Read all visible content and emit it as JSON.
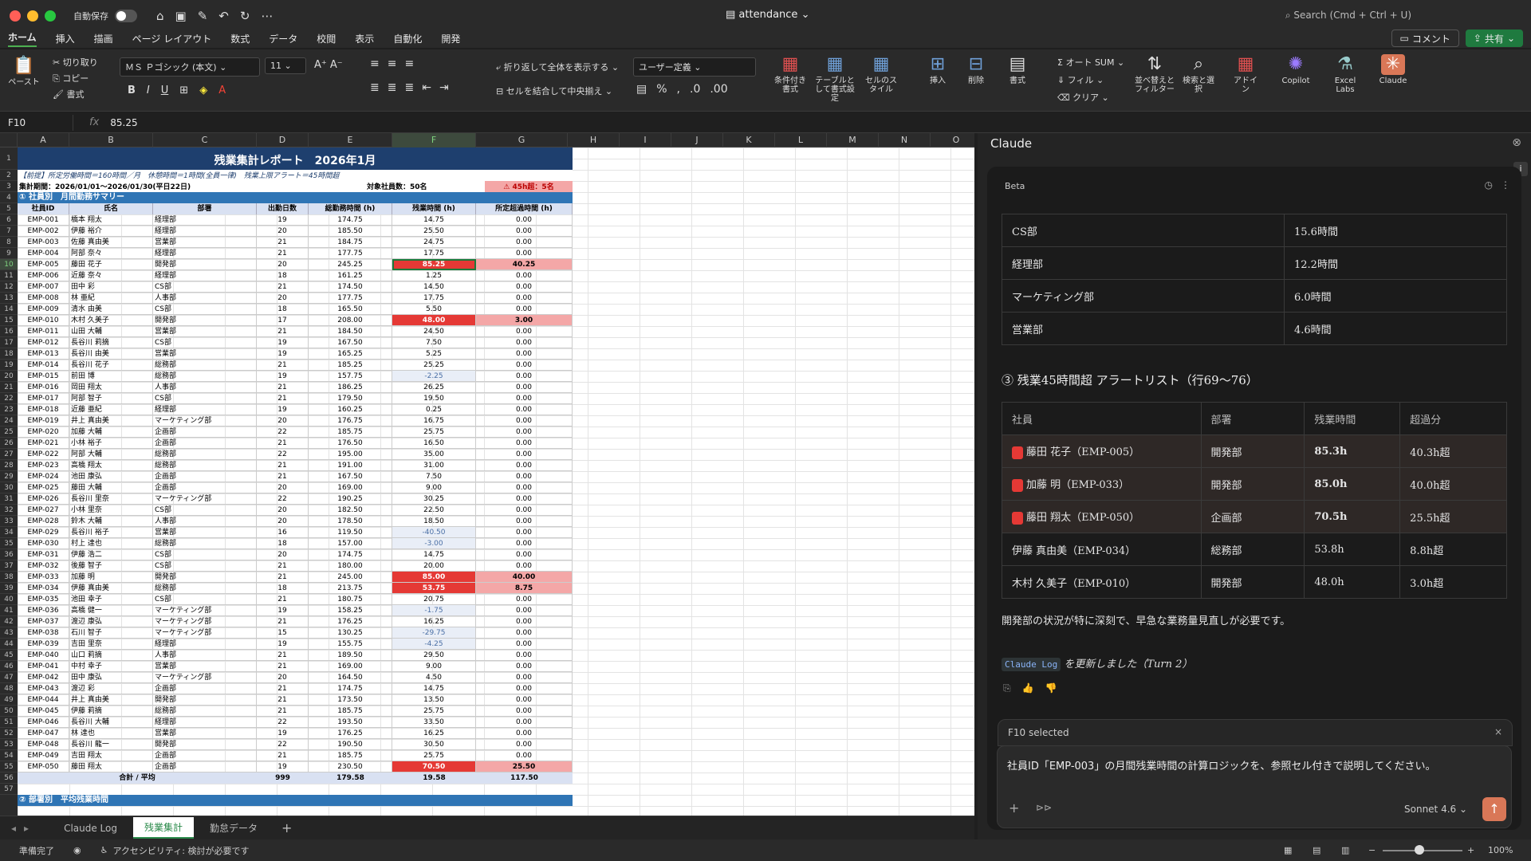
{
  "window": {
    "autosave": "自動保存",
    "doc_title": "attendance",
    "search": "Search (Cmd + Ctrl + U)"
  },
  "menu": {
    "tabs": [
      "ホーム",
      "挿入",
      "描画",
      "ページ レイアウト",
      "数式",
      "データ",
      "校閲",
      "表示",
      "自動化",
      "開発"
    ],
    "comment": "コメント",
    "share": "共有"
  },
  "ribbon": {
    "paste": "ペースト",
    "cut": "切り取り",
    "copy": "コピー",
    "format": "書式",
    "font_name": "ＭＳ Ｐゴシック (本文)",
    "font_size": "11",
    "wrap": "折り返して全体を表示する",
    "merge": "セルを結合して中央揃え",
    "number_format": "ユーザー定義",
    "cond": "条件付き書式",
    "table": "テーブルとして書式設定",
    "cellstyle": "セルのスタイル",
    "insert": "挿入",
    "delete": "削除",
    "format2": "書式",
    "autosum": "オート SUM",
    "fill": "フィル",
    "clear": "クリア",
    "sort": "並べ替えとフィルター",
    "find": "検索と選択",
    "addin": "アドイン",
    "copilot": "Copilot",
    "labs": "Excel Labs",
    "claude": "Claude"
  },
  "formula": {
    "cell": "F10",
    "value": "85.25"
  },
  "columns": [
    "A",
    "B",
    "C",
    "D",
    "E",
    "F",
    "G",
    "H",
    "I",
    "J",
    "K",
    "L",
    "M",
    "N",
    "O"
  ],
  "sheet": {
    "title": "残業集計レポート　2026年1月",
    "premise": "【前提】所定労働時間＝160時間／月　休憩時間＝1時間(全員一律)　残業上限アラート＝45時間超",
    "period": "集計期間：2026/01/01〜2026/01/30(平日22日)",
    "employees": "対象社員数：50名",
    "alert": "45h超：5名",
    "section1": "① 社員別　月間勤務サマリー",
    "headers": [
      "社員ID",
      "氏名",
      "部署",
      "出勤日数",
      "総勤務時間 (h)",
      "残業時間 (h)",
      "所定超過時間 (h)"
    ],
    "rows": [
      [
        "EMP-001",
        "橋本 翔太",
        "経理部",
        "19",
        "174.75",
        "14.75",
        "0.00"
      ],
      [
        "EMP-002",
        "伊藤 裕介",
        "経理部",
        "20",
        "185.50",
        "25.50",
        "0.00"
      ],
      [
        "EMP-003",
        "佐藤 真由美",
        "営業部",
        "21",
        "184.75",
        "24.75",
        "0.00"
      ],
      [
        "EMP-004",
        "阿部 奈々",
        "経理部",
        "21",
        "177.75",
        "17.75",
        "0.00"
      ],
      [
        "EMP-005",
        "藤田 花子",
        "開発部",
        "20",
        "245.25",
        "85.25",
        "40.25"
      ],
      [
        "EMP-006",
        "近藤 奈々",
        "経理部",
        "18",
        "161.25",
        "1.25",
        "0.00"
      ],
      [
        "EMP-007",
        "田中 彩",
        "CS部",
        "21",
        "174.50",
        "14.50",
        "0.00"
      ],
      [
        "EMP-008",
        "林 亜紀",
        "人事部",
        "20",
        "177.75",
        "17.75",
        "0.00"
      ],
      [
        "EMP-009",
        "清水 由美",
        "CS部",
        "18",
        "165.50",
        "5.50",
        "0.00"
      ],
      [
        "EMP-010",
        "木村 久美子",
        "開発部",
        "17",
        "208.00",
        "48.00",
        "3.00"
      ],
      [
        "EMP-011",
        "山田 大輔",
        "営業部",
        "21",
        "184.50",
        "24.50",
        "0.00"
      ],
      [
        "EMP-012",
        "長谷川 莉摘",
        "CS部",
        "19",
        "167.50",
        "7.50",
        "0.00"
      ],
      [
        "EMP-013",
        "長谷川 由美",
        "営業部",
        "19",
        "165.25",
        "5.25",
        "0.00"
      ],
      [
        "EMP-014",
        "長谷川 花子",
        "総務部",
        "21",
        "185.25",
        "25.25",
        "0.00"
      ],
      [
        "EMP-015",
        "前田 博",
        "総務部",
        "19",
        "157.75",
        "-2.25",
        "0.00"
      ],
      [
        "EMP-016",
        "岡田 翔太",
        "人事部",
        "21",
        "186.25",
        "26.25",
        "0.00"
      ],
      [
        "EMP-017",
        "阿部 智子",
        "CS部",
        "21",
        "179.50",
        "19.50",
        "0.00"
      ],
      [
        "EMP-018",
        "近藤 亜紀",
        "経理部",
        "19",
        "160.25",
        "0.25",
        "0.00"
      ],
      [
        "EMP-019",
        "井上 真由美",
        "マーケティング部",
        "20",
        "176.75",
        "16.75",
        "0.00"
      ],
      [
        "EMP-020",
        "加藤 大輔",
        "企画部",
        "22",
        "185.75",
        "25.75",
        "0.00"
      ],
      [
        "EMP-021",
        "小林 裕子",
        "企画部",
        "21",
        "176.50",
        "16.50",
        "0.00"
      ],
      [
        "EMP-022",
        "阿部 大輔",
        "総務部",
        "22",
        "195.00",
        "35.00",
        "0.00"
      ],
      [
        "EMP-023",
        "高橋 翔太",
        "総務部",
        "21",
        "191.00",
        "31.00",
        "0.00"
      ],
      [
        "EMP-024",
        "池田 康弘",
        "企画部",
        "21",
        "167.50",
        "7.50",
        "0.00"
      ],
      [
        "EMP-025",
        "藤田 大輔",
        "企画部",
        "20",
        "169.00",
        "9.00",
        "0.00"
      ],
      [
        "EMP-026",
        "長谷川 里奈",
        "マーケティング部",
        "22",
        "190.25",
        "30.25",
        "0.00"
      ],
      [
        "EMP-027",
        "小林 里奈",
        "CS部",
        "20",
        "182.50",
        "22.50",
        "0.00"
      ],
      [
        "EMP-028",
        "鈴木 大輔",
        "人事部",
        "20",
        "178.50",
        "18.50",
        "0.00"
      ],
      [
        "EMP-029",
        "長谷川 裕子",
        "営業部",
        "16",
        "119.50",
        "-40.50",
        "0.00"
      ],
      [
        "EMP-030",
        "村上 達也",
        "総務部",
        "18",
        "157.00",
        "-3.00",
        "0.00"
      ],
      [
        "EMP-031",
        "伊藤 浩二",
        "CS部",
        "20",
        "174.75",
        "14.75",
        "0.00"
      ],
      [
        "EMP-032",
        "後藤 智子",
        "CS部",
        "21",
        "180.00",
        "20.00",
        "0.00"
      ],
      [
        "EMP-033",
        "加藤 明",
        "開発部",
        "21",
        "245.00",
        "85.00",
        "40.00"
      ],
      [
        "EMP-034",
        "伊藤 真由美",
        "総務部",
        "18",
        "213.75",
        "53.75",
        "8.75"
      ],
      [
        "EMP-035",
        "池田 幸子",
        "CS部",
        "21",
        "180.75",
        "20.75",
        "0.00"
      ],
      [
        "EMP-036",
        "高橋 健一",
        "マーケティング部",
        "19",
        "158.25",
        "-1.75",
        "0.00"
      ],
      [
        "EMP-037",
        "渡辺 康弘",
        "マーケティング部",
        "21",
        "176.25",
        "16.25",
        "0.00"
      ],
      [
        "EMP-038",
        "石川 智子",
        "マーケティング部",
        "15",
        "130.25",
        "-29.75",
        "0.00"
      ],
      [
        "EMP-039",
        "吉田 里奈",
        "経理部",
        "19",
        "155.75",
        "-4.25",
        "0.00"
      ],
      [
        "EMP-040",
        "山口 莉摘",
        "人事部",
        "21",
        "189.50",
        "29.50",
        "0.00"
      ],
      [
        "EMP-041",
        "中村 幸子",
        "営業部",
        "21",
        "169.00",
        "9.00",
        "0.00"
      ],
      [
        "EMP-042",
        "田中 康弘",
        "マーケティング部",
        "20",
        "164.50",
        "4.50",
        "0.00"
      ],
      [
        "EMP-043",
        "渡辺 彩",
        "企画部",
        "21",
        "174.75",
        "14.75",
        "0.00"
      ],
      [
        "EMP-044",
        "井上 真由美",
        "開発部",
        "21",
        "173.50",
        "13.50",
        "0.00"
      ],
      [
        "EMP-045",
        "伊藤 莉摘",
        "総務部",
        "21",
        "185.75",
        "25.75",
        "0.00"
      ],
      [
        "EMP-046",
        "長谷川 大輔",
        "経理部",
        "22",
        "193.50",
        "33.50",
        "0.00"
      ],
      [
        "EMP-047",
        "林 達也",
        "営業部",
        "19",
        "176.25",
        "16.25",
        "0.00"
      ],
      [
        "EMP-048",
        "長谷川 龍一",
        "開発部",
        "22",
        "190.50",
        "30.50",
        "0.00"
      ],
      [
        "EMP-049",
        "吉田 翔太",
        "企画部",
        "21",
        "185.75",
        "25.75",
        "0.00"
      ],
      [
        "EMP-050",
        "藤田 翔太",
        "企画部",
        "19",
        "230.50",
        "70.50",
        "25.50"
      ]
    ],
    "total": [
      "合計 / 平均",
      "999",
      "179.58",
      "19.58",
      "117.50"
    ],
    "section2": "② 部署別　平均残業時間"
  },
  "sheet_tabs": [
    "Claude Log",
    "残業集計",
    "勤怠データ"
  ],
  "status": {
    "ready": "準備完了",
    "access": "アクセシビリティ: 検討が必要です",
    "zoom": "100%"
  },
  "panel": {
    "title": "Claude",
    "beta": "Beta",
    "dept_table": [
      [
        "CS部",
        "15.6時間"
      ],
      [
        "経理部",
        "12.2時間"
      ],
      [
        "マーケティング部",
        "6.0時間"
      ],
      [
        "営業部",
        "4.6時間"
      ]
    ],
    "heading": "③ 残業45時間超 アラートリスト（行69〜76）",
    "alert_headers": [
      "社員",
      "部署",
      "残業時間",
      "超過分"
    ],
    "alert_rows": [
      [
        "藤田 花子（EMP-005）",
        "開発部",
        "85.3h",
        "40.3h超"
      ],
      [
        "加藤 明（EMP-033）",
        "開発部",
        "85.0h",
        "40.0h超"
      ],
      [
        "藤田 翔太（EMP-050）",
        "企画部",
        "70.5h",
        "25.5h超"
      ],
      [
        "伊藤 真由美（EMP-034）",
        "総務部",
        "53.8h",
        "8.8h超"
      ],
      [
        "木村 久美子（EMP-010）",
        "開発部",
        "48.0h",
        "3.0h超"
      ]
    ],
    "summary": "開発部の状況が特に深刻で、早急な業務量見直しが必要です。",
    "log_tag": "Claude Log",
    "log_text": "を更新しました（Turn 2）",
    "selected": "F10 selected",
    "input_text": "社員ID「EMP-003」の月間残業時間の計算ロジックを、参照セル付きで説明してください。",
    "model": "Sonnet 4.6"
  }
}
